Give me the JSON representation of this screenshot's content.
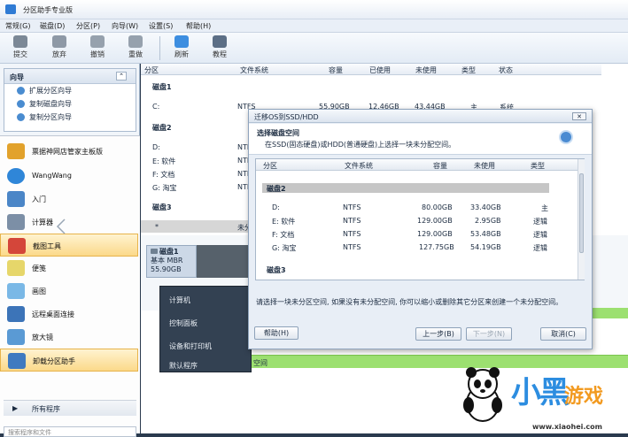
{
  "app": {
    "title": "分区助手专业版"
  },
  "menu": [
    "常规(G)",
    "磁盘(D)",
    "分区(P)",
    "向导(W)",
    "设置(S)",
    "帮助(H)"
  ],
  "toolbar": {
    "submit": "提交",
    "discard": "放弃",
    "undo": "撤销",
    "redo": "重做",
    "refresh": "刷新",
    "tutorial": "教程"
  },
  "wizard": {
    "title": "向导",
    "items": [
      "扩展分区向导",
      "复制磁盘向导",
      "复制分区向导"
    ]
  },
  "start_menu": {
    "items": [
      "票据神网店管家主板版",
      "WangWang",
      "入门",
      "计算器",
      "截图工具",
      "便笺",
      "画图",
      "远程桌面连接",
      "放大镜",
      "卸载分区助手"
    ],
    "all_programs": "所有程序",
    "search_placeholder": "搜索程序和文件"
  },
  "columns": [
    "分区",
    "文件系统",
    "容量",
    "已使用",
    "未使用",
    "类型",
    "状态"
  ],
  "main_rows": {
    "disk1": "磁盘1",
    "c": {
      "part": "C:",
      "fs": "NTFS",
      "cap": "55.90GB",
      "used": "12.46GB",
      "free": "43.44GB",
      "type": "主",
      "status": "系统"
    },
    "disk2": "磁盘2",
    "d": {
      "part": "D:",
      "fs": "NTF"
    },
    "e": {
      "part": "E: 软件",
      "fs": "NTF"
    },
    "f": {
      "part": "F: 文档",
      "fs": "NTF"
    },
    "g": {
      "part": "G: 淘宝",
      "fs": "NTF"
    },
    "disk3": "磁盘3",
    "star": {
      "part": "*",
      "fs": "未分"
    }
  },
  "diskmap": {
    "name": "磁盘1",
    "kind": "基本 MBR",
    "size": "55.90GB",
    "green_label": "空间"
  },
  "popup_menu": [
    "计算机",
    "控制面板",
    "设备和打印机",
    "默认程序"
  ],
  "dialog": {
    "title": "迁移OS到SSD/HDD",
    "heading": "选择磁盘空间",
    "subheading": "在SSD(固态硬盘)或HDD(普通硬盘)上选择一块未分配空间。",
    "columns": [
      "分区",
      "文件系统",
      "容量",
      "未使用",
      "类型"
    ],
    "disk2": "磁盘2",
    "disk3": "磁盘3",
    "rows": [
      {
        "part": "D:",
        "fs": "NTFS",
        "cap": "80.00GB",
        "free": "33.40GB",
        "type": "主"
      },
      {
        "part": "E: 软件",
        "fs": "NTFS",
        "cap": "129.00GB",
        "free": "2.95GB",
        "type": "逻辑"
      },
      {
        "part": "F: 文档",
        "fs": "NTFS",
        "cap": "129.00GB",
        "free": "53.48GB",
        "type": "逻辑"
      },
      {
        "part": "G: 淘宝",
        "fs": "NTFS",
        "cap": "127.75GB",
        "free": "54.19GB",
        "type": "逻辑"
      }
    ],
    "message": "请选择一块未分区空间, 如果没有未分配空间, 你可以缩小或删除其它分区来创建一个未分配空间。",
    "buttons": {
      "help": "帮助(H)",
      "prev": "上一步(B)",
      "next": "下一步(N)",
      "cancel": "取消(C)"
    }
  },
  "watermark": {
    "brand": "小黑",
    "brand2": "游戏",
    "url": "www.xiaohei.com"
  }
}
